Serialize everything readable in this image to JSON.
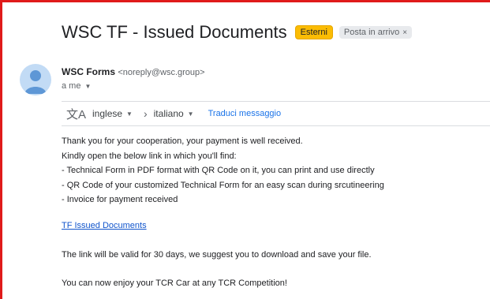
{
  "email": {
    "subject": "WSC TF - Issued Documents",
    "labels": {
      "external": "Esterni",
      "inbox": "Posta in arrivo",
      "inbox_remove": "×"
    },
    "sender": {
      "name": "WSC Forms",
      "email": "<noreply@wsc.group>"
    },
    "recipient": "a me"
  },
  "translate": {
    "source_lang": "inglese",
    "target_lang": "italiano",
    "action": "Traduci messaggio"
  },
  "body": {
    "lines": [
      "Thank you for your cooperation, your payment is well received.",
      "Kindly open the below link in which you'll find:",
      "- Technical Form in PDF format with QR Code on it, you can print and use directly",
      "- QR Code of your customized Technical Form for an easy scan during srcutineering",
      "- Invoice for payment received"
    ],
    "link_text": "TF Issued Documents",
    "validity": "The link will be valid for 30 days, we suggest you to download and save your file.",
    "closing": "You can now enjoy your TCR Car at any TCR Competition!"
  },
  "colors": {
    "frame": "#e01b1b",
    "esterni_label": "#fbbc04",
    "link": "#1155cc",
    "translate_link": "#1a73e8"
  },
  "icons": [
    "avatar-icon",
    "caret-down-icon",
    "translate-icon",
    "chevron-right-icon",
    "close-icon"
  ]
}
